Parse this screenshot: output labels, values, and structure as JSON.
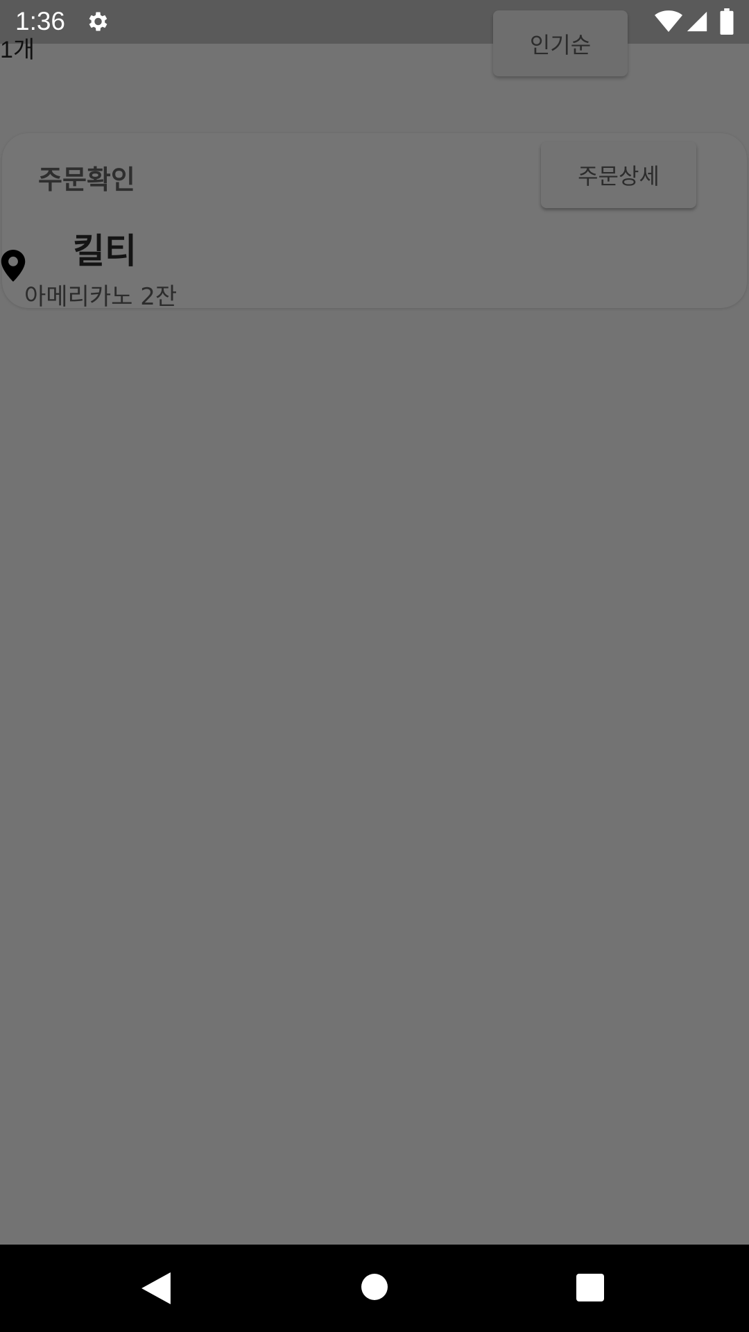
{
  "status_bar": {
    "time": "1:36",
    "icons": [
      "gear-icon",
      "wifi-icon",
      "signal-icon",
      "battery-icon"
    ]
  },
  "list": {
    "count_label": "1개",
    "sort_label": "인기순"
  },
  "order_card": {
    "title": "주문확인",
    "detail_button": "주문상세",
    "shop_name": "킬티",
    "items": "아메리카노 2잔"
  },
  "nav_bar": {
    "icons": [
      "back-icon",
      "home-icon",
      "recent-apps-icon"
    ]
  },
  "colors": {
    "scrim": "#737373",
    "status_bar": "#5a5a5a",
    "nav_bar": "#000000"
  }
}
